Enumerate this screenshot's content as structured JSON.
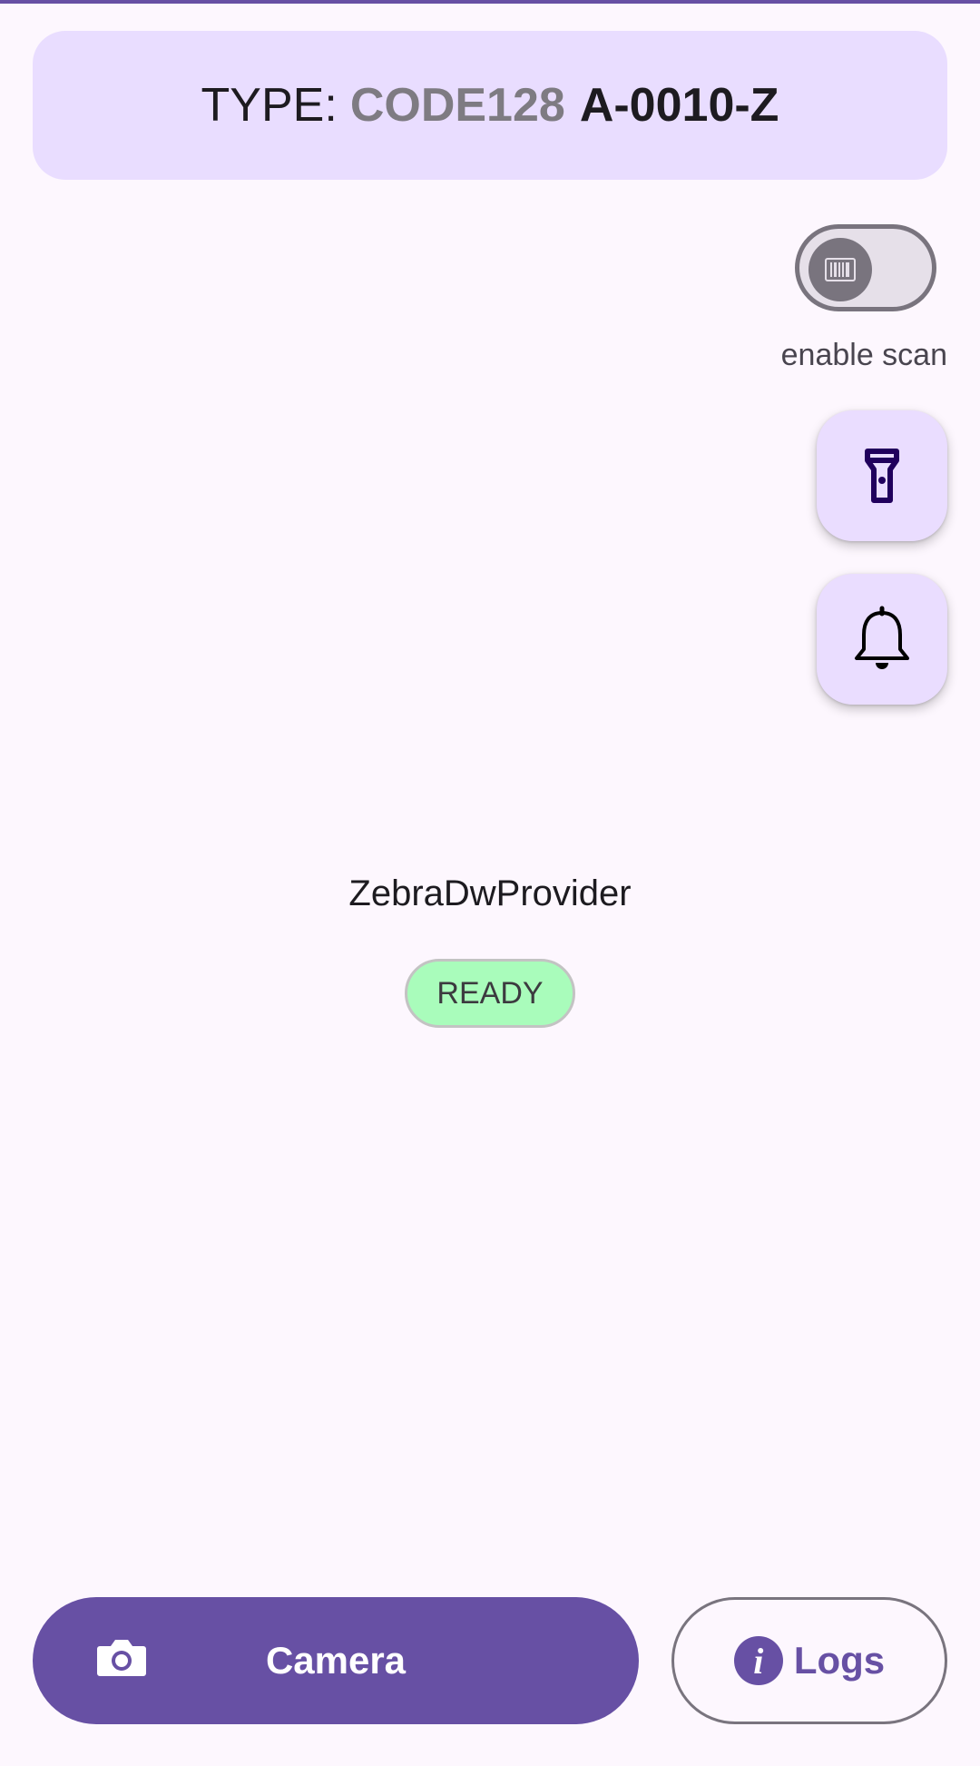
{
  "result": {
    "type_label": "TYPE:",
    "type_value": "CODE128",
    "code_value": "A-0010-Z"
  },
  "scan_toggle": {
    "label": "enable scan",
    "enabled": false,
    "thumb_icon": "barcode-icon"
  },
  "fabs": {
    "torch_icon": "flashlight-icon",
    "bell_icon": "bell-icon"
  },
  "provider": {
    "name": "ZebraDwProvider",
    "status": "READY"
  },
  "bottom": {
    "camera_label": "Camera",
    "camera_icon": "camera-icon",
    "logs_label": "Logs",
    "logs_icon": "info-icon"
  },
  "colors": {
    "primary": "#6750a4",
    "card_bg": "#e9ddff",
    "status_ready": "#a9fcbb",
    "background": "#fdf7fe"
  }
}
